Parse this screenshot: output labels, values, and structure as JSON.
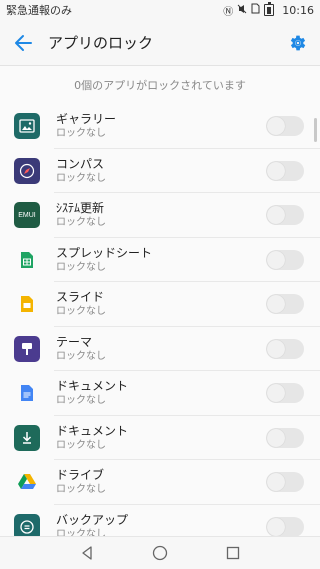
{
  "statusbar": {
    "carrier_text": "緊急通報のみ",
    "time": "10:16"
  },
  "appbar": {
    "title": "アプリのロック"
  },
  "summary": "0個のアプリがロックされています",
  "apps": [
    {
      "name": "ギャラリー",
      "status": "ロックなし",
      "icon": "gallery-icon",
      "color": "#1e6a67",
      "locked": false
    },
    {
      "name": "コンパス",
      "status": "ロックなし",
      "icon": "compass-icon",
      "color": "#3b3a78",
      "locked": false
    },
    {
      "name": "ｼｽﾃﾑ更新",
      "status": "ロックなし",
      "icon": "emui-update-icon",
      "color": "#1f5b43",
      "icon_text": "EMUI",
      "locked": false
    },
    {
      "name": "スプレッドシート",
      "status": "ロックなし",
      "icon": "sheets-icon",
      "color": "#1fa463",
      "locked": false
    },
    {
      "name": "スライド",
      "status": "ロックなし",
      "icon": "slides-icon",
      "color": "#f4b400",
      "locked": false
    },
    {
      "name": "テーマ",
      "status": "ロックなし",
      "icon": "theme-brush-icon",
      "color": "#4b3b8f",
      "locked": false
    },
    {
      "name": "ドキュメント",
      "status": "ロックなし",
      "icon": "docs-icon",
      "color": "#4285f4",
      "locked": false
    },
    {
      "name": "ドキュメント",
      "status": "ロックなし",
      "icon": "download-icon",
      "color": "#1e6a5a",
      "locked": false
    },
    {
      "name": "ドライブ",
      "status": "ロックなし",
      "icon": "drive-icon",
      "color": "#0f9d58",
      "locked": false
    },
    {
      "name": "バックアップ",
      "status": "ロックなし",
      "icon": "backup-icon",
      "color": "#1e6a6a",
      "locked": false
    }
  ],
  "colors": {
    "accent": "#1e88e5",
    "toggle_off": "#e6e6e6"
  }
}
